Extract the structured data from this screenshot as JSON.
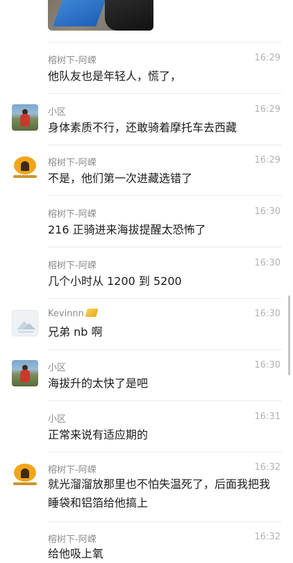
{
  "messages": [
    {
      "name": "榕树下-阿嵘",
      "time": "16:29",
      "text": "他队友也是年轻人，慌了，",
      "avatar": "none"
    },
    {
      "name": "小区",
      "time": "16:29",
      "text": "身体素质不行，还敢骑着摩托车去西藏",
      "avatar": "photo"
    },
    {
      "name": "榕树下-阿嵘",
      "time": "16:29",
      "text": "不是，他们第一次进藏选错了",
      "avatar": "logo"
    },
    {
      "name": "榕树下-阿嵘",
      "time": "16:30",
      "text": "216 正骑进来海拔提醒太恐怖了",
      "avatar": "none"
    },
    {
      "name": "榕树下-阿嵘",
      "time": "16:30",
      "text": "几个小时从 1200 到 5200",
      "avatar": "none"
    },
    {
      "name": "Kevinnn",
      "time": "16:30",
      "text": "兄弟 nb 啊",
      "avatar": "placeholder"
    },
    {
      "name": "小区",
      "time": "16:30",
      "text": "海拔升的太快了是吧",
      "avatar": "photo"
    },
    {
      "name": "小区",
      "time": "16:31",
      "text": "正常来说有适应期的",
      "avatar": "none"
    },
    {
      "name": "榕树下-阿嵘",
      "time": "16:32",
      "text": "就光溜溜放那里也不怕失温死了，后面我把我睡袋和铝箔给他搞上",
      "avatar": "logo"
    },
    {
      "name": "榕树下-阿嵘",
      "time": "16:32",
      "text": "给他吸上氧",
      "avatar": "none"
    }
  ],
  "icons": {
    "kevin_badge": "gold-badge-icon"
  }
}
